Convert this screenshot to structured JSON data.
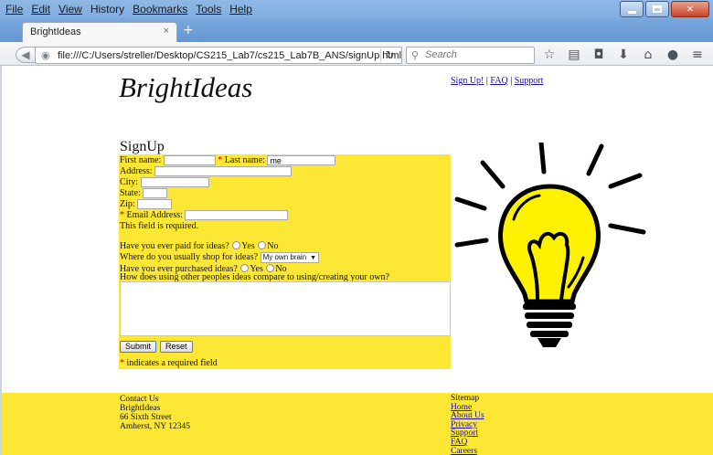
{
  "window": {
    "menu": [
      "File",
      "Edit",
      "View",
      "History",
      "Bookmarks",
      "Tools",
      "Help"
    ],
    "tab_title": "BrightIdeas",
    "tab_close": "×",
    "new_tab": "+",
    "url": "file:///C:/Users/streller/Desktop/CS215_Lab7/cs215_Lab7B_ANS/signUp.html",
    "search_placeholder": "Search"
  },
  "header": {
    "logo": "BrightIdeas",
    "links": [
      "Sign Up!",
      "FAQ",
      "Support"
    ],
    "separator": "|"
  },
  "form": {
    "title": "SignUp",
    "first_name_label": "First name:",
    "first_name_value": "",
    "required_mark": "*",
    "last_name_label": "Last name:",
    "last_name_value": "me",
    "address_label": "Address:",
    "city_label": "City:",
    "state_label": "State:",
    "zip_label": "Zip:",
    "email_label": "Email Address:",
    "email_error": "This field is required.",
    "paid_question": "Have you ever paid for ideas?",
    "yes": "Yes",
    "no": "No",
    "shop_question": "Where do you usually shop for ideas?",
    "shop_selected": "My own brain",
    "purchased_question": "Have you ever purchased ideas?",
    "compare_question": "How does using other peoples ideas compare to using/creating your own?",
    "submit": "Submit",
    "reset": "Reset",
    "required_note": "indicates a required field"
  },
  "footer": {
    "contact": [
      "Contact Us",
      "BrightIdeas",
      "66 Sixth Street",
      "Amherst, NY 12345"
    ],
    "sitemap_title": "Sitemap",
    "sitemap_links": [
      "Home",
      "About Us",
      "Privacy",
      "Support",
      "FAQ",
      "Careers"
    ]
  },
  "colors": {
    "accent_yellow": "#fce735",
    "titlebar_blue": "#6e9fd8",
    "link_blue": "#1a0dab"
  }
}
